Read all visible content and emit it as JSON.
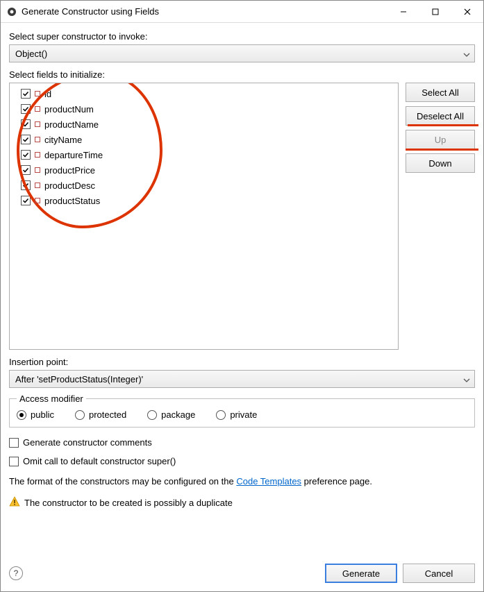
{
  "window": {
    "title": "Generate Constructor using Fields"
  },
  "labels": {
    "select_super": "Select super constructor to invoke:",
    "select_fields": "Select fields to initialize:",
    "insertion_point": "Insertion point:",
    "access_modifier": "Access modifier"
  },
  "super_combo": {
    "value": "Object()"
  },
  "fields": [
    {
      "name": "id",
      "checked": true
    },
    {
      "name": "productNum",
      "checked": true
    },
    {
      "name": "productName",
      "checked": true
    },
    {
      "name": "cityName",
      "checked": true
    },
    {
      "name": "departureTime",
      "checked": true
    },
    {
      "name": "productPrice",
      "checked": true
    },
    {
      "name": "productDesc",
      "checked": true
    },
    {
      "name": "productStatus",
      "checked": true
    }
  ],
  "side_buttons": {
    "select_all": "Select All",
    "deselect_all": "Deselect All",
    "up": "Up",
    "down": "Down"
  },
  "insertion_combo": {
    "value": "After 'setProductStatus(Integer)'"
  },
  "modifiers": {
    "public": "public",
    "protected": "protected",
    "package": "package",
    "private": "private",
    "selected": "public"
  },
  "options": {
    "gen_comments": "Generate constructor comments",
    "omit_super": "Omit call to default constructor super()"
  },
  "hint": {
    "pre": "The format of the constructors may be configured on the ",
    "link": "Code Templates",
    "post": " preference page."
  },
  "warning": "The constructor to be created is possibly a duplicate",
  "footer": {
    "generate": "Generate",
    "cancel": "Cancel",
    "help": "?"
  }
}
